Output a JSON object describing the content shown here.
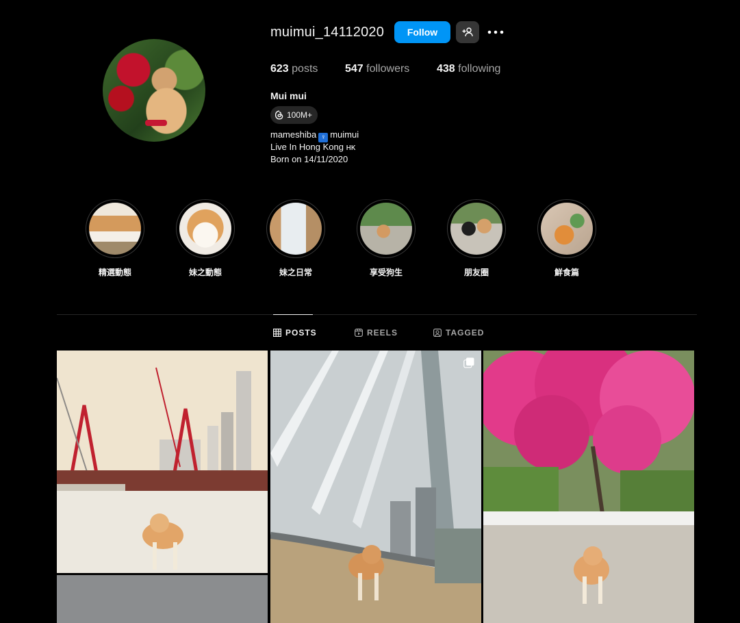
{
  "profile": {
    "username": "muimui_14112020",
    "follow_label": "Follow",
    "posts_count": "623",
    "posts_label": "posts",
    "followers_count": "547",
    "followers_label": "followers",
    "following_count": "438",
    "following_label": "following",
    "full_name": "Mui mui",
    "threads_badge": "100M+",
    "bio": {
      "line1_a": "mameshiba",
      "line1_b": "muimui",
      "line2": "Live In Hong Kong ʜᴋ",
      "line3": "Born on 14/11/2020"
    }
  },
  "highlights": [
    {
      "label": "精選動態"
    },
    {
      "label": "妹之動態"
    },
    {
      "label": "妹之日常"
    },
    {
      "label": "享受狗生"
    },
    {
      "label": "朋友圈"
    },
    {
      "label": "鮮食篇"
    }
  ],
  "tabs": [
    {
      "label": "POSTS",
      "icon": "grid-icon",
      "active": true
    },
    {
      "label": "REELS",
      "icon": "reels-icon",
      "active": false
    },
    {
      "label": "TAGGED",
      "icon": "tagged-icon",
      "active": false
    }
  ],
  "colors": {
    "accent": "#0095f6",
    "background": "#000000",
    "secondary_button": "#363636"
  }
}
